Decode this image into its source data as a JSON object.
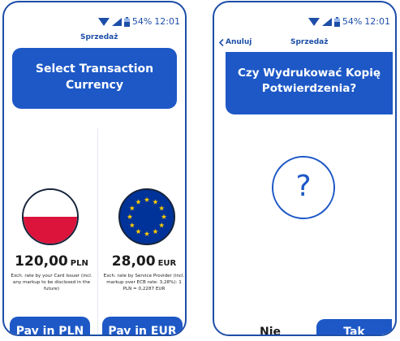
{
  "status": {
    "battery": "54%",
    "time": "12:01"
  },
  "left": {
    "title": "Sprzedaż",
    "header": "Select Transaction Currency",
    "options": [
      {
        "amount": "120,00",
        "currency": "PLN",
        "note": "Exch. rate by your Card Issuer (incl. any markup to be disclosed in the future)",
        "button": "Pay in PLN"
      },
      {
        "amount": "28,00",
        "currency": "EUR",
        "note": "Exch. rate by Service Provider (incl. markup over ECB rate: 3,28%): 1 PLN = 0,2287 EUR",
        "button": "Pay in EUR"
      }
    ]
  },
  "right": {
    "back_label": "Anuluj",
    "title": "Sprzedaż",
    "header": "Czy Wydrukować Kopię Potwierdzenia?",
    "question_mark": "?",
    "no_label": "Nie",
    "yes_label": "Tak"
  },
  "colors": {
    "brand_blue": "#1d58c6",
    "flag_red": "#dc143c",
    "eu_blue": "#003399",
    "eu_star": "#ffcc00"
  },
  "icons": [
    "wifi-icon",
    "signal-icon",
    "battery-icon",
    "chevron-left-icon",
    "poland-flag-icon",
    "eu-flag-icon"
  ]
}
